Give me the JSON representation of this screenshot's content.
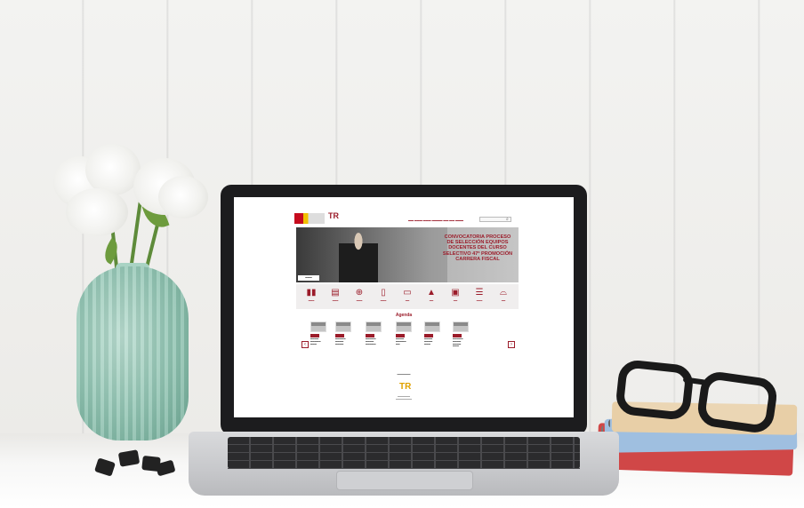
{
  "hero": {
    "title": "CONVOCATORIA PROCESO DE SELECCIÓN EQUIPOS DOCENTES DEL CURSO SELECTIVO 47ª PROMOCIÓN CARRERA FISCAL"
  },
  "agenda": {
    "title": "Agenda"
  },
  "icons": [
    {
      "name": "book-icon",
      "glyph": "▮▮"
    },
    {
      "name": "document-icon",
      "glyph": "▤"
    },
    {
      "name": "globe-icon",
      "glyph": "⊕"
    },
    {
      "name": "page-icon",
      "glyph": "▯"
    },
    {
      "name": "monitor-icon",
      "glyph": "▭"
    },
    {
      "name": "graduation-cap-icon",
      "glyph": "▲"
    },
    {
      "name": "image-icon",
      "glyph": "▣"
    },
    {
      "name": "list-icon",
      "glyph": "☰"
    },
    {
      "name": "inbox-icon",
      "glyph": "⌓"
    }
  ],
  "colors": {
    "brand": "#9b1c2a",
    "accent_gold": "#e0a100"
  }
}
